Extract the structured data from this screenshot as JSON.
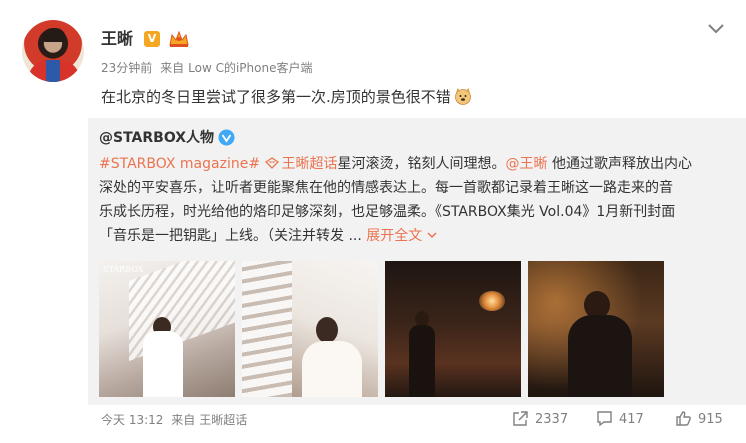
{
  "post": {
    "author": "王晰",
    "verified_badge": "V",
    "time": "23分钟前",
    "source_prefix": "来自",
    "source": "Low C的iPhone客户端",
    "text": "在北京的冬日里尝试了很多第一次.房顶的景色很不错"
  },
  "repost": {
    "author": "@STARBOX人物",
    "lines": [
      {
        "hashtag": "#STARBOX magazine#",
        "supertopic": "王晰超话",
        "rest": "星河滚烫，铭刻人间理想。",
        "mention": "@王晰",
        "tail": " 他通过歌声释放出内心"
      },
      {
        "text": "深处的平安喜乐，让听者更能聚焦在他的情感表达上。每一首歌都记录着王晰这一路走来的音"
      },
      {
        "text": "乐成长历程，时光给他的烙印足够深刻，也足够温柔。《STARBOX集光 Vol.04》1月新刊封面"
      },
      {
        "text": "「音乐是一把钥匙」上线。（关注并转发 ...",
        "expand": "展开全文"
      }
    ],
    "photos": [
      {
        "alt": "photo-1"
      },
      {
        "alt": "photo-2"
      },
      {
        "alt": "photo-3"
      },
      {
        "alt": "photo-4"
      }
    ],
    "photo1_logo": "STARBOX"
  },
  "footer": {
    "time": "今天 13:12",
    "source_prefix": "来自",
    "source": "王晰超话",
    "reposts": "2337",
    "comments": "417",
    "likes": "915"
  },
  "colors": {
    "link": "#eb7350",
    "muted": "#808080",
    "repost_bg": "#f2f2f2",
    "verified_blue": "#3fa9f5",
    "badge_orange": "#f5a623"
  },
  "icons": [
    "chevron-down-icon",
    "verified-badge-icon",
    "member-crown-icon",
    "doge-emoji-icon",
    "supertopic-icon",
    "blue-v-icon",
    "repost-icon",
    "comment-icon",
    "like-icon"
  ]
}
